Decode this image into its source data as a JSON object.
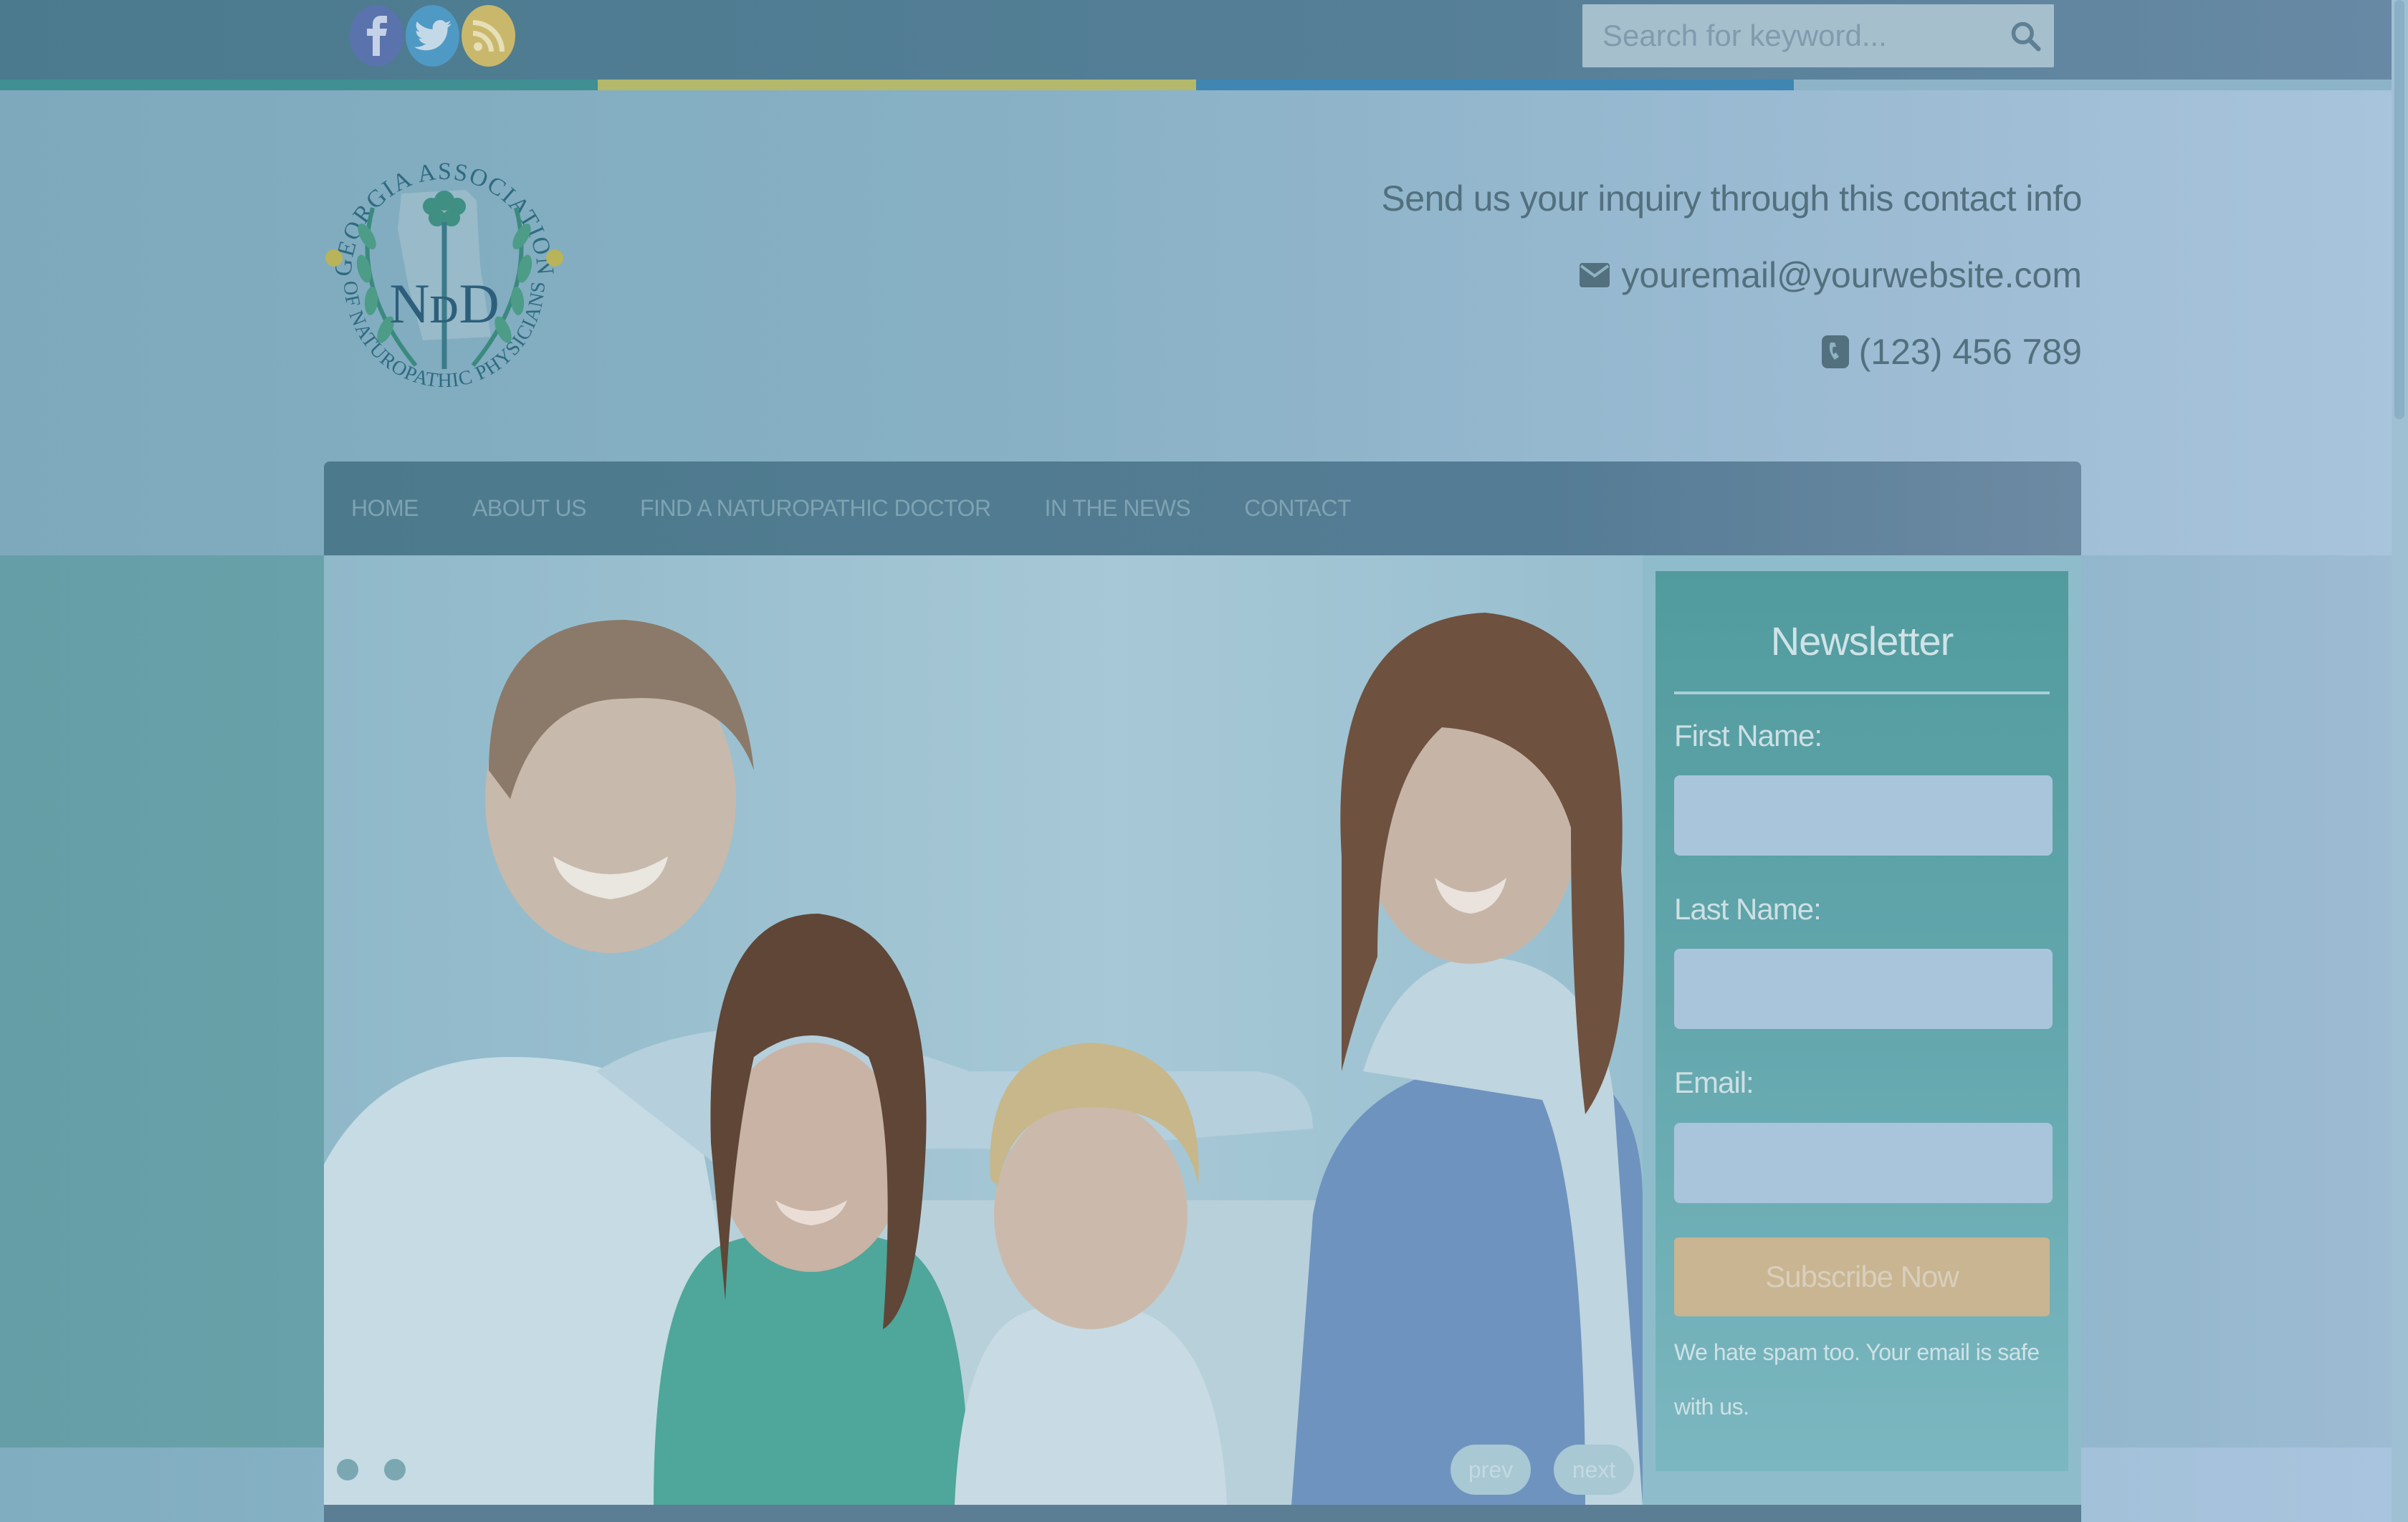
{
  "social": {
    "facebook_icon": "facebook-icon",
    "twitter_icon": "twitter-icon",
    "rss_icon": "rss-icon",
    "colors": {
      "facebook": "#5a73ad",
      "twitter": "#4f9ac4",
      "rss": "#c9b86b"
    }
  },
  "search": {
    "placeholder": "Search for keyword..."
  },
  "strip_colors": [
    "#3f8f93",
    "#b4b86a",
    "#3f86b2",
    "#8db4c6"
  ],
  "logo": {
    "text_top": "GEORGIA ASSOCIATION",
    "text_bottom": "OF NATUROPATHIC PHYSICIANS",
    "monogram": "NᴅD"
  },
  "contact": {
    "intro": "Send us your inquiry through this contact info",
    "email": "youremail@yourwebsite.com",
    "phone": "(123) 456 789"
  },
  "nav": {
    "items": [
      "HOME",
      "ABOUT US",
      "FIND A NATUROPATHIC DOCTOR",
      "IN THE NEWS",
      "CONTACT"
    ]
  },
  "slider": {
    "prev": "prev",
    "next": "next"
  },
  "newsletter": {
    "title": "Newsletter",
    "first_name_label": "First Name:",
    "last_name_label": "Last Name:",
    "email_label": "Email:",
    "button": "Subscribe Now",
    "note": "We hate spam too. Your email is safe with us."
  }
}
